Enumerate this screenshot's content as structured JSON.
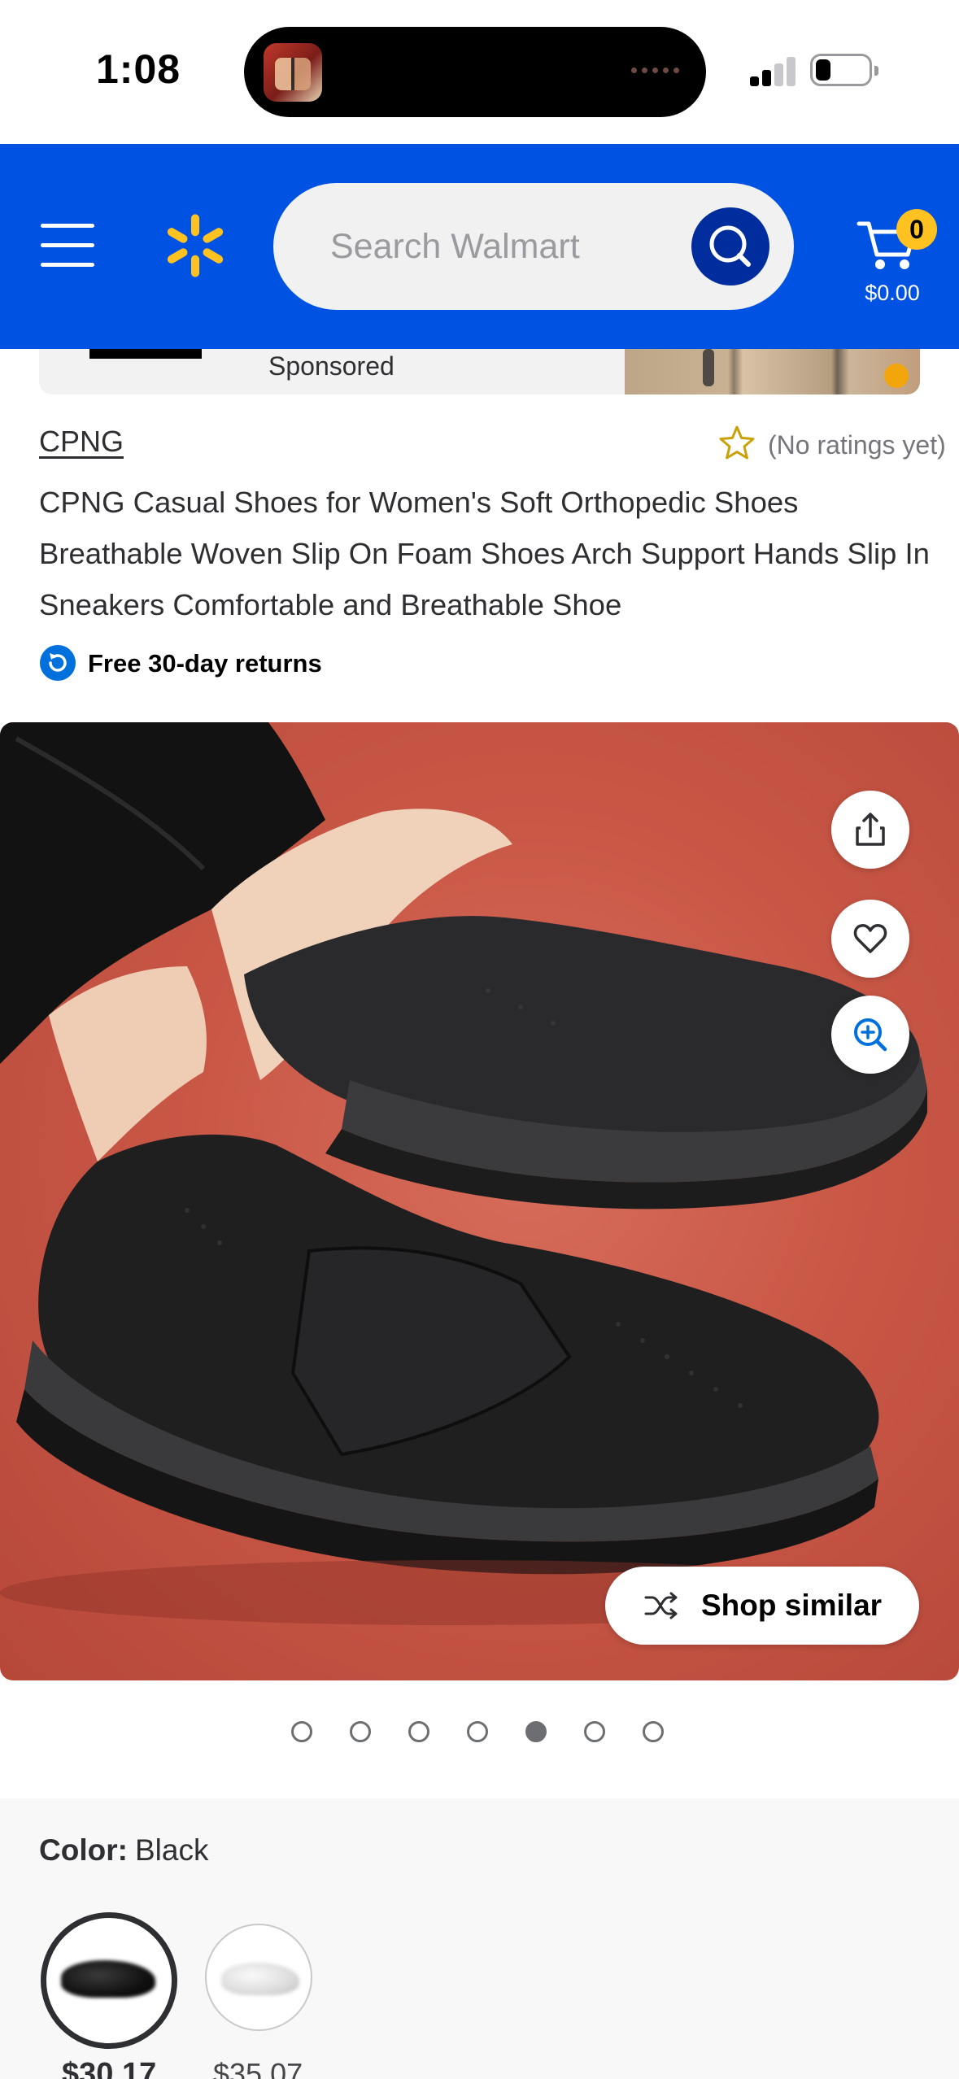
{
  "status_bar": {
    "time": "1:08"
  },
  "header": {
    "search": {
      "placeholder": "Search Walmart"
    },
    "cart": {
      "count": "0",
      "total": "$0.00"
    },
    "brand_color": "#0053e2",
    "spark_color": "#ffc220"
  },
  "sponsored": {
    "label": "Sponsored"
  },
  "product": {
    "brand": "CPNG",
    "rating_text": "(No ratings yet)",
    "title": "CPNG Casual Shoes for Women's Soft Orthopedic Shoes Breathable Woven Slip On Foam Shoes Arch Support Hands Slip In Sneakers Comfortable and Breathable Shoe",
    "returns_text": "Free 30-day returns"
  },
  "gallery": {
    "shop_similar_label": "Shop similar",
    "image_count": 7,
    "active_index": 4,
    "actions": [
      "share-icon",
      "heart-icon",
      "zoom-in-icon"
    ]
  },
  "variants": {
    "color_label": "Color:",
    "color_value": "Black",
    "options": [
      {
        "color": "Black",
        "price": "$30.17",
        "selected": true
      },
      {
        "color": "White",
        "price": "$35.07",
        "selected": false
      }
    ]
  }
}
